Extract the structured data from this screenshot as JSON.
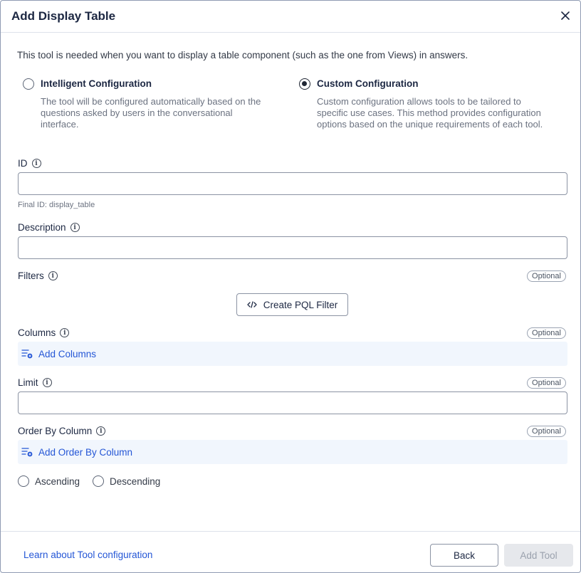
{
  "dialog": {
    "title": "Add Display Table",
    "close_icon": "close-icon"
  },
  "intro": "This tool is needed when you want to display a table component (such as the one from Views) in answers.",
  "config_options": [
    {
      "title": "Intelligent Configuration",
      "desc_lines": [
        "The tool will be configured automatically based on the",
        "questions asked by users in the conversational",
        "interface."
      ],
      "checked": false
    },
    {
      "title": "Custom Configuration",
      "desc_lines": [
        "Custom configuration allows tools to be tailored to",
        "specific use cases. This method provides configuration",
        "options based on the unique requirements of each tool."
      ],
      "checked": true
    }
  ],
  "fields": {
    "id": {
      "label": "ID",
      "value": "",
      "hint": "Final ID: display_table"
    },
    "description": {
      "label": "Description",
      "value": ""
    },
    "filters": {
      "label": "Filters",
      "badge": "Optional",
      "button_label": "Create PQL Filter"
    },
    "columns": {
      "label": "Columns",
      "badge": "Optional",
      "add_label": "Add Columns"
    },
    "limit": {
      "label": "Limit",
      "badge": "Optional",
      "value": ""
    },
    "order_by": {
      "label": "Order By Column",
      "badge": "Optional",
      "add_label": "Add Order By Column",
      "ascending_label": "Ascending",
      "descending_label": "Descending",
      "selected": "none"
    }
  },
  "footer": {
    "learn_link": "Learn about Tool configuration",
    "back_label": "Back",
    "add_tool_label": "Add Tool",
    "add_tool_enabled": false
  },
  "colors": {
    "link": "#2456d6",
    "add_row_bg": "#f1f6fd",
    "title": "#1c2742",
    "disabled_bg": "#e6e8ec"
  }
}
